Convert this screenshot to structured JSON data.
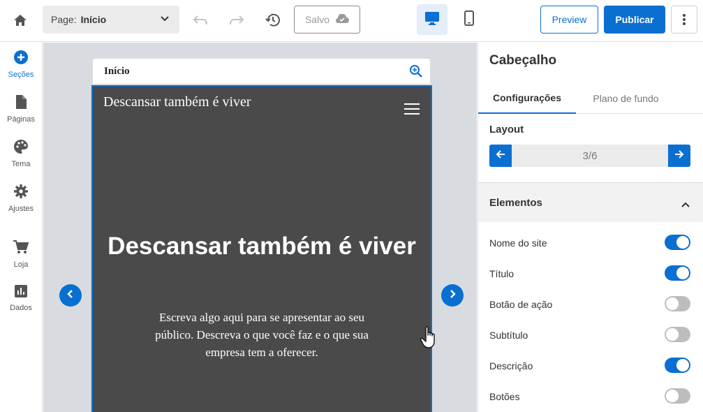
{
  "topbar": {
    "page_prefix": "Page:",
    "page_value": "Início",
    "saved_label": "Salvo",
    "preview_label": "Preview",
    "publish_label": "Publicar"
  },
  "leftnav": {
    "items": [
      {
        "label": "Seções",
        "icon": "plus-circle-icon"
      },
      {
        "label": "Páginas",
        "icon": "page-icon"
      },
      {
        "label": "Tema",
        "icon": "palette-icon"
      },
      {
        "label": "Ajustes",
        "icon": "gear-icon"
      },
      {
        "label": "Loja",
        "icon": "cart-icon"
      },
      {
        "label": "Dados",
        "icon": "chart-icon"
      }
    ]
  },
  "canvas": {
    "page_title": "Início",
    "site_name": "Descansar também é viver",
    "headline": "Descansar também é viver",
    "description": "Escreva algo aqui para se apresentar ao seu público. Descreva o que você faz e o que sua empresa tem a oferecer."
  },
  "panel": {
    "title": "Cabeçalho",
    "tabs": [
      {
        "label": "Configurações",
        "active": true
      },
      {
        "label": "Plano de fundo",
        "active": false
      }
    ],
    "layout_label": "Layout",
    "layout_value": "3/6",
    "elements_label": "Elementos",
    "toggles": [
      {
        "label": "Nome do site",
        "on": true
      },
      {
        "label": "Título",
        "on": true
      },
      {
        "label": "Botão de ação",
        "on": false
      },
      {
        "label": "Subtítulo",
        "on": false
      },
      {
        "label": "Descrição",
        "on": true
      },
      {
        "label": "Botões",
        "on": false
      }
    ]
  },
  "colors": {
    "accent": "#0a6fd1",
    "canvas_bg": "#d8dce0",
    "hero_bg": "#4a4a4a"
  }
}
